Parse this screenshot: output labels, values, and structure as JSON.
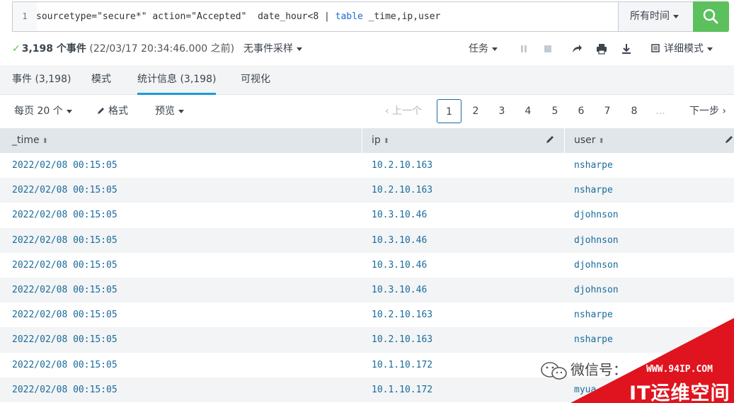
{
  "search": {
    "line_number": "1",
    "query_before": "sourcetype=\"secure*\" action=\"Accepted\"  date_hour<8 | ",
    "query_keyword": "table",
    "query_after": " _time,ip,user",
    "time_range": "所有时间"
  },
  "status": {
    "event_count": "3,198 个事件",
    "since": "(22/03/17 20:34:46.000 之前)",
    "sampling": "无事件采样",
    "job": "任务",
    "mode": "详细模式"
  },
  "tabs": [
    {
      "label": "事件 (3,198)"
    },
    {
      "label": "模式"
    },
    {
      "label": "统计信息 (3,198)"
    },
    {
      "label": "可视化"
    }
  ],
  "toolbar": {
    "per_page": "每页 20 个",
    "format": "格式",
    "preview": "预览"
  },
  "pagination": {
    "prev": "‹ 上一个",
    "pages": [
      "1",
      "2",
      "3",
      "4",
      "5",
      "6",
      "7",
      "8",
      "..."
    ],
    "next": "下一步 ›"
  },
  "table": {
    "columns": [
      "_time",
      "ip",
      "user"
    ],
    "rows": [
      [
        "2022/02/08 00:15:05",
        "10.2.10.163",
        "nsharpe"
      ],
      [
        "2022/02/08 00:15:05",
        "10.2.10.163",
        "nsharpe"
      ],
      [
        "2022/02/08 00:15:05",
        "10.3.10.46",
        "djohnson"
      ],
      [
        "2022/02/08 00:15:05",
        "10.3.10.46",
        "djohnson"
      ],
      [
        "2022/02/08 00:15:05",
        "10.3.10.46",
        "djohnson"
      ],
      [
        "2022/02/08 00:15:05",
        "10.3.10.46",
        "djohnson"
      ],
      [
        "2022/02/08 00:15:05",
        "10.2.10.163",
        "nsharpe"
      ],
      [
        "2022/02/08 00:15:05",
        "10.2.10.163",
        "nsharpe"
      ],
      [
        "2022/02/08 00:15:05",
        "10.1.10.172",
        ""
      ],
      [
        "2022/02/08 00:15:05",
        "10.1.10.172",
        "myua"
      ]
    ]
  },
  "watermark": {
    "chat": "微信号：",
    "url": "WWW.94IP.COM",
    "brand": "IT运维空间"
  },
  "colors": {
    "search_green": "#5cc05c",
    "tab_accent": "#1a9cd8",
    "link_blue": "#1a6b9c",
    "watermark_red": "#e0141e"
  }
}
